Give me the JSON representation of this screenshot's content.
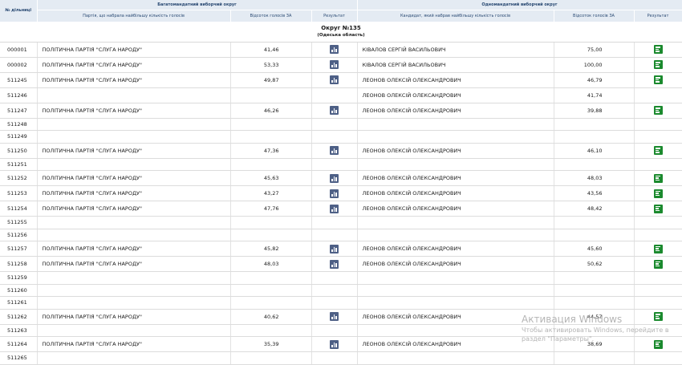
{
  "header": {
    "col_num": "№ дільниці",
    "multi_group": "Багатомандатний виборчий округ",
    "single_group": "Одномандатний виборчий округ",
    "party_col": "Партія, що набрала найбільшу кількість голосів",
    "pct_col": "Відсоток голосів ЗА",
    "result_col": "Результат",
    "candidate_col": "Кандидат, який набрав найбільшу кількість голосів",
    "pct_col2": "Відсоток голосів ЗА",
    "result_col2": "Результат"
  },
  "okrug": {
    "title": "Округ №135",
    "region": "(Одеська область)"
  },
  "rows": [
    {
      "num": "000001",
      "party": "ПОЛІТИЧНА ПАРТІЯ \"СЛУГА НАРОДУ\"",
      "pct": "41,46",
      "cand": "КІВАЛОВ СЕРГІЙ ВАСИЛЬОВИЧ",
      "pct2": "75,00"
    },
    {
      "num": "000002",
      "party": "ПОЛІТИЧНА ПАРТІЯ \"СЛУГА НАРОДУ\"",
      "pct": "53,33",
      "cand": "КІВАЛОВ СЕРГІЙ ВАСИЛЬОВИЧ",
      "pct2": "100,00"
    },
    {
      "num": "511245",
      "party": "ПОЛІТИЧНА ПАРТІЯ \"СЛУГА НАРОДУ\"",
      "pct": "49,87",
      "cand": "ЛЕОНОВ ОЛЕКСІЙ ОЛЕКСАНДРОВИЧ",
      "pct2": "46,79"
    },
    {
      "num": "511246",
      "party": "",
      "pct": "",
      "cand": "ЛЕОНОВ ОЛЕКСІЙ ОЛЕКСАНДРОВИЧ",
      "pct2": "41,74"
    },
    {
      "num": "511247",
      "party": "ПОЛІТИЧНА ПАРТІЯ \"СЛУГА НАРОДУ\"",
      "pct": "46,26",
      "cand": "ЛЕОНОВ ОЛЕКСІЙ ОЛЕКСАНДРОВИЧ",
      "pct2": "39,88"
    },
    {
      "num": "511248",
      "party": "",
      "pct": "",
      "cand": "",
      "pct2": ""
    },
    {
      "num": "511249",
      "party": "",
      "pct": "",
      "cand": "",
      "pct2": ""
    },
    {
      "num": "511250",
      "party": "ПОЛІТИЧНА ПАРТІЯ \"СЛУГА НАРОДУ\"",
      "pct": "47,36",
      "cand": "ЛЕОНОВ ОЛЕКСІЙ ОЛЕКСАНДРОВИЧ",
      "pct2": "46,10"
    },
    {
      "num": "511251",
      "party": "",
      "pct": "",
      "cand": "",
      "pct2": ""
    },
    {
      "num": "511252",
      "party": "ПОЛІТИЧНА ПАРТІЯ \"СЛУГА НАРОДУ\"",
      "pct": "45,63",
      "cand": "ЛЕОНОВ ОЛЕКСІЙ ОЛЕКСАНДРОВИЧ",
      "pct2": "48,03"
    },
    {
      "num": "511253",
      "party": "ПОЛІТИЧНА ПАРТІЯ \"СЛУГА НАРОДУ\"",
      "pct": "43,27",
      "cand": "ЛЕОНОВ ОЛЕКСІЙ ОЛЕКСАНДРОВИЧ",
      "pct2": "43,56"
    },
    {
      "num": "511254",
      "party": "ПОЛІТИЧНА ПАРТІЯ \"СЛУГА НАРОДУ\"",
      "pct": "47,76",
      "cand": "ЛЕОНОВ ОЛЕКСІЙ ОЛЕКСАНДРОВИЧ",
      "pct2": "48,42"
    },
    {
      "num": "511255",
      "party": "",
      "pct": "",
      "cand": "",
      "pct2": ""
    },
    {
      "num": "511256",
      "party": "",
      "pct": "",
      "cand": "",
      "pct2": ""
    },
    {
      "num": "511257",
      "party": "ПОЛІТИЧНА ПАРТІЯ \"СЛУГА НАРОДУ\"",
      "pct": "45,82",
      "cand": "ЛЕОНОВ ОЛЕКСІЙ ОЛЕКСАНДРОВИЧ",
      "pct2": "45,60"
    },
    {
      "num": "511258",
      "party": "ПОЛІТИЧНА ПАРТІЯ \"СЛУГА НАРОДУ\"",
      "pct": "48,03",
      "cand": "ЛЕОНОВ ОЛЕКСІЙ ОЛЕКСАНДРОВИЧ",
      "pct2": "50,62"
    },
    {
      "num": "511259",
      "party": "",
      "pct": "",
      "cand": "",
      "pct2": ""
    },
    {
      "num": "511260",
      "party": "",
      "pct": "",
      "cand": "",
      "pct2": ""
    },
    {
      "num": "511261",
      "party": "",
      "pct": "",
      "cand": "",
      "pct2": ""
    },
    {
      "num": "511262",
      "party": "ПОЛІТИЧНА ПАРТІЯ \"СЛУГА НАРОДУ\"",
      "pct": "40,62",
      "cand": "ЛЕОНОВ ОЛЕКСІЙ ОЛЕКСАНДРОВИЧ",
      "pct2": "44,57"
    },
    {
      "num": "511263",
      "party": "",
      "pct": "",
      "cand": "",
      "pct2": ""
    },
    {
      "num": "511264",
      "party": "ПОЛІТИЧНА ПАРТІЯ \"СЛУГА НАРОДУ\"",
      "pct": "35,39",
      "cand": "ЛЕОНОВ ОЛЕКСІЙ ОЛЕКСАНДРОВИЧ",
      "pct2": "38,69"
    },
    {
      "num": "511265",
      "party": "",
      "pct": "",
      "cand": "",
      "pct2": ""
    }
  ],
  "watermark": {
    "title": "Активация Windows",
    "text": "Чтобы активировать Windows, перейдите в раздел \"Параметры\"."
  },
  "colors": {
    "header_bg": "#e4ebf3",
    "multi_icon": "#4e6086",
    "single_icon": "#1b8a2e"
  }
}
